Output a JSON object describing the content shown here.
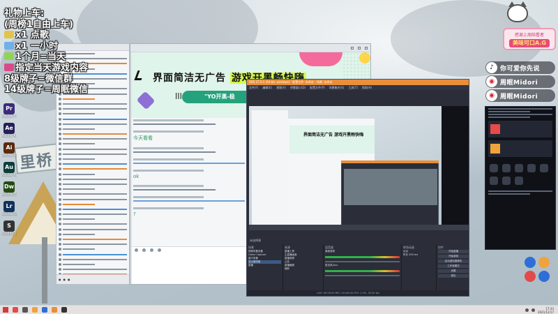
{
  "overlay": {
    "lines": [
      {
        "text": "礼物上车:",
        "glyph": ""
      },
      {
        "text": "(周榜1自由上车)",
        "glyph": ""
      },
      {
        "text": "x1  点歌",
        "glyph": "#e3c44a"
      },
      {
        "text": "x1  一小时",
        "glyph": "#6fb0e8"
      },
      {
        "text": "1个月=当天",
        "glyph": "#8fd45a"
      },
      {
        "text": "指定当天游戏内容",
        "glyph": "#d94a8a"
      },
      {
        "text": "8级牌子=微信群",
        "glyph": ""
      },
      {
        "text": "14级牌子=周眠微信",
        "glyph": ""
      }
    ]
  },
  "desktop_icons": [
    {
      "name": "pr-icon",
      "label": "Adobe Premi...",
      "text": "Pr",
      "color": "#3b2b7a"
    },
    {
      "name": "ae-icon",
      "label": "Adobe After...",
      "text": "Ae",
      "color": "#23205a"
    },
    {
      "name": "ai-icon",
      "label": "Adobe Illustr...",
      "text": "Ai",
      "color": "#5a2a10"
    },
    {
      "name": "au-icon",
      "label": "Adobe Auditi...",
      "text": "Au",
      "color": "#0b3d3a"
    },
    {
      "name": "dw-icon",
      "label": "Adobe Dreamw...",
      "text": "Dw",
      "color": "#244a12"
    },
    {
      "name": "lr-icon",
      "label": "Adobe Lightro...",
      "text": "Lr",
      "color": "#12325a"
    },
    {
      "name": "studio-icon",
      "label": "Studio One",
      "text": "S",
      "color": "#333333"
    }
  ],
  "qq": {
    "title": "",
    "banner": {
      "headline_a": "界面简洁无广告",
      "headline_b": "游戏开黑畅快嗨",
      "bars_text": "|||",
      "pill_text": "\"YO开黑-极"
    },
    "messages": [
      {
        "text": ""
      },
      {
        "text": "今天看看"
      },
      {
        "text": ""
      },
      {
        "text": "",
        "has_blue": true
      },
      {
        "text": "ok"
      },
      {
        "text": ""
      },
      {
        "text": "",
        "has_blue": true
      },
      {
        "text": "?"
      }
    ]
  },
  "obs": {
    "title": "OBS 27.0.1 (64-bit, windows) - 配置文件: 未命名 - 场景: 未命名",
    "menu": [
      "文件(F)",
      "编辑(E)",
      "视图(V)",
      "停靠窗口(D)",
      "配置文件(P)",
      "场景集合(S)",
      "工具(T)",
      "帮助(H)"
    ],
    "nested_headline": "界面简洁无广告  游戏开黑畅快嗨",
    "scene_label": "未选择源",
    "docks": {
      "scenes_header": "场景",
      "scenes": [
        "视频采集设备",
        "Game Capture",
        "窗口采集",
        "显示器采集",
        "直播"
      ],
      "sources_header": "来源",
      "sources": [
        "直播工具",
        "主直播画面",
        "直播音频",
        "公告",
        "直播截图",
        "捕获"
      ],
      "mixer_header": "混音器",
      "mixer": [
        "桌面音频",
        "麦克风/Aux"
      ],
      "transitions_header": "转场动画",
      "transitions": [
        "淡出",
        "时长  300 ms"
      ],
      "controls_header": "控件",
      "controls": [
        "开始直播",
        "开始录制",
        "启动虚拟摄像机",
        "工作室模式",
        "设置",
        "退出"
      ]
    },
    "status": "LIVE: 00:00:00   REC: 00:00:00   CPU: 2.3%, 30.00 fps"
  },
  "sticker": {
    "line1": "感谢上周陪看者",
    "line2": "美味可口A.G"
  },
  "social": [
    {
      "name": "douyin",
      "icon": "♪",
      "icon_color": "#111111",
      "text": "你可爱你先说"
    },
    {
      "name": "weibo",
      "icon": "◉",
      "icon_color": "#e6162d",
      "text": "周眠Midori"
    },
    {
      "name": "weibo-2",
      "icon": "◉",
      "icon_color": "#e6162d",
      "text": "周眠Midori"
    }
  ],
  "taskbar": {
    "time": "17:33",
    "date": "2021/12/17"
  },
  "colors": {
    "obs_accent": "#e98e3b",
    "banner_green": "#24a27c",
    "banner_highlight": "#d6f74a"
  }
}
